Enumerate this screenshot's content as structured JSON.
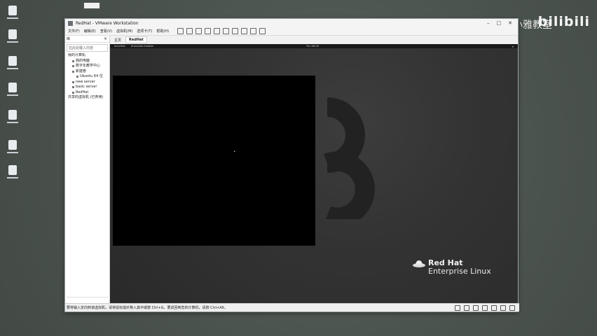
{
  "window": {
    "title": "RedHat - VMware Workstation",
    "controls": [
      "–",
      "□",
      "✕"
    ]
  },
  "menu": {
    "items": [
      "文件(F)",
      "编辑(E)",
      "查看(V)",
      "虚拟机(M)",
      "选项卡(T)",
      "帮助(H)"
    ]
  },
  "library": {
    "header": "库",
    "close": "×",
    "search_placeholder": "在此处键入内容",
    "tree": [
      {
        "label": "我的计算机",
        "indent": 0
      },
      {
        "label": "我的电脑",
        "indent": 1
      },
      {
        "label": "数字化教学中心",
        "indent": 1
      },
      {
        "label": "新建卷",
        "indent": 1
      },
      {
        "label": "Ubuntu 64 位",
        "indent": 2
      },
      {
        "label": "new server",
        "indent": 1
      },
      {
        "label": "basic server",
        "indent": 1
      },
      {
        "label": "RedHat",
        "indent": 1
      },
      {
        "label": "共享的虚拟机 (已弃用)",
        "indent": 0
      }
    ]
  },
  "vm": {
    "home_label": "主页",
    "tab_label": "RedHat",
    "topbar_activities": "Activities",
    "topbar_app": "Anaconda Installer",
    "topbar_clock": "Thu 08:26",
    "logo_line1": "Red Hat",
    "logo_line2": "Enterprise Linux"
  },
  "status": {
    "text": "要将输入定向到该虚拟机，请将鼠标指针移入其中或按 Ctrl+G。要返回到您的计算机，请按 Ctrl+Alt。"
  },
  "overlay": {
    "watermark": "bilibili",
    "watermark_cn": "小雅教室"
  },
  "colors": {
    "desktop": "#4d5650",
    "vm_background": "#2b2b2b",
    "accent_red": "#ee0000"
  }
}
